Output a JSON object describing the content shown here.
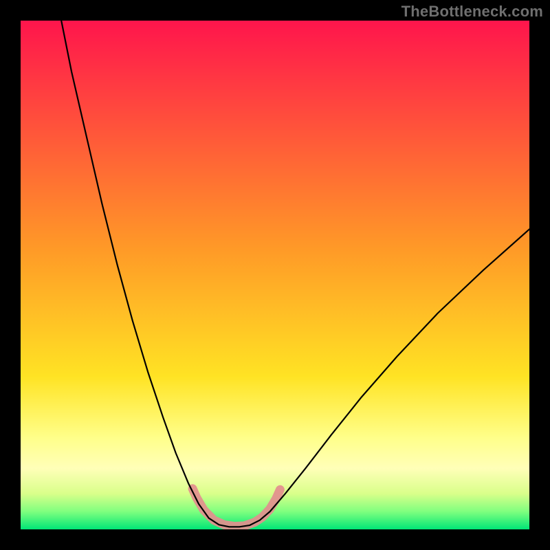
{
  "watermark": "TheBottleneck.com",
  "chart_data": {
    "type": "line",
    "title": "",
    "xlabel": "",
    "ylabel": "",
    "xlim": [
      0,
      100
    ],
    "ylim": [
      0,
      100
    ],
    "background_gradient": {
      "stops": [
        {
          "offset": 0.0,
          "color": "#ff154c"
        },
        {
          "offset": 0.45,
          "color": "#ff9a27"
        },
        {
          "offset": 0.7,
          "color": "#ffe324"
        },
        {
          "offset": 0.82,
          "color": "#ffff8a"
        },
        {
          "offset": 0.88,
          "color": "#ffffb8"
        },
        {
          "offset": 0.93,
          "color": "#d9ff8a"
        },
        {
          "offset": 0.965,
          "color": "#7fff7f"
        },
        {
          "offset": 1.0,
          "color": "#00e676"
        }
      ]
    },
    "series": [
      {
        "name": "bottleneck-curve",
        "stroke": "#000000",
        "stroke_width": 2.2,
        "points": [
          {
            "x": 8.0,
            "y": 100.0
          },
          {
            "x": 10.0,
            "y": 90.0
          },
          {
            "x": 13.0,
            "y": 77.0
          },
          {
            "x": 16.0,
            "y": 64.0
          },
          {
            "x": 19.0,
            "y": 52.0
          },
          {
            "x": 22.0,
            "y": 41.0
          },
          {
            "x": 25.0,
            "y": 31.0
          },
          {
            "x": 28.0,
            "y": 22.0
          },
          {
            "x": 30.5,
            "y": 15.0
          },
          {
            "x": 33.0,
            "y": 9.0
          },
          {
            "x": 35.0,
            "y": 5.0
          },
          {
            "x": 37.0,
            "y": 2.2
          },
          {
            "x": 39.0,
            "y": 0.9
          },
          {
            "x": 41.0,
            "y": 0.5
          },
          {
            "x": 43.0,
            "y": 0.5
          },
          {
            "x": 45.0,
            "y": 0.8
          },
          {
            "x": 47.0,
            "y": 1.8
          },
          {
            "x": 49.0,
            "y": 3.5
          },
          {
            "x": 52.0,
            "y": 7.0
          },
          {
            "x": 56.0,
            "y": 12.0
          },
          {
            "x": 61.0,
            "y": 18.5
          },
          {
            "x": 67.0,
            "y": 26.0
          },
          {
            "x": 74.0,
            "y": 34.0
          },
          {
            "x": 82.0,
            "y": 42.5
          },
          {
            "x": 91.0,
            "y": 51.0
          },
          {
            "x": 100.0,
            "y": 59.0
          }
        ]
      },
      {
        "name": "highlight-band",
        "stroke": "#e38e8e",
        "stroke_width": 13,
        "linecap": "round",
        "points": [
          {
            "x": 33.8,
            "y": 8.0
          },
          {
            "x": 34.6,
            "y": 6.2
          },
          {
            "x": 36.0,
            "y": 3.8
          },
          {
            "x": 38.0,
            "y": 1.8
          },
          {
            "x": 40.0,
            "y": 0.9
          },
          {
            "x": 42.0,
            "y": 0.6
          },
          {
            "x": 44.0,
            "y": 0.7
          },
          {
            "x": 46.0,
            "y": 1.4
          },
          {
            "x": 47.5,
            "y": 2.4
          },
          {
            "x": 49.0,
            "y": 4.0
          },
          {
            "x": 50.2,
            "y": 6.0
          },
          {
            "x": 51.0,
            "y": 7.8
          }
        ]
      }
    ]
  }
}
